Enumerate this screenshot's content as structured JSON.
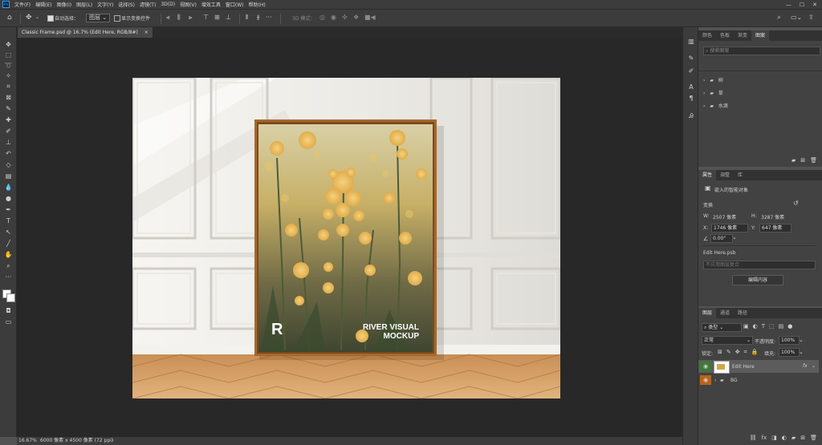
{
  "app": {
    "logo": "Ps"
  },
  "menu": [
    "文件(F)",
    "编辑(E)",
    "图像(I)",
    "图层(L)",
    "文字(Y)",
    "选择(S)",
    "滤镜(T)",
    "3D(D)",
    "视图(V)",
    "增效工具",
    "窗口(W)",
    "帮助(H)"
  ],
  "window_controls": {
    "minimize": "—",
    "maximize": "☐",
    "close": "✕"
  },
  "options": {
    "auto_select_label": "自动选择：",
    "auto_select_value": "图层",
    "show_transform_label": "显示变换控件",
    "mode3d_label": "3D 模式：",
    "more": "···"
  },
  "document_tab": {
    "title": "Classic Frame.psd @ 16.7% (Edit Here, RGB/8#)",
    "close": "×"
  },
  "artwork": {
    "watermark_letter": "R",
    "line1": "RIVER VISUAL",
    "line2": "MOCKUP"
  },
  "status": {
    "zoom": "16.67%",
    "doc_info": "6000 像素 x 4500 像素 (72 ppi)",
    "arrow": "›"
  },
  "color_panel": {
    "tabs": [
      "颜色",
      "色板",
      "渐变",
      "图案"
    ],
    "active_tab": 3,
    "search_placeholder": "搜索图案",
    "groups": [
      {
        "name": "树",
        "caret": "›"
      },
      {
        "name": "草",
        "caret": "›"
      },
      {
        "name": "水滴",
        "caret": "›"
      }
    ]
  },
  "properties": {
    "tabs": [
      "属性",
      "调整",
      "库"
    ],
    "active_tab": 0,
    "type_label": "嵌入的智能对象",
    "transform_label": "变换",
    "w_label": "W:",
    "w_value": "2507 像素",
    "h_label": "H:",
    "h_value": "3287 像素",
    "x_label": "X:",
    "x_value": "1746 像素",
    "y_label": "Y:",
    "y_value": "647 像素",
    "angle_value": "0.00°",
    "file_name": "Edit Here.psb",
    "comp_placeholder": "不应用图层复合",
    "edit_button": "编辑内容"
  },
  "layers": {
    "tabs": [
      "图层",
      "通道",
      "路径"
    ],
    "active_tab": 0,
    "filter_label": "类型",
    "blend_mode": "正常",
    "opacity_label": "不透明度:",
    "opacity_value": "100%",
    "lock_label": "锁定:",
    "fill_label": "填充:",
    "fill_value": "100%",
    "items": [
      {
        "name": "Edit Here",
        "fx": "fx",
        "selected": true,
        "eye_color": "#3f7a39"
      },
      {
        "name": "BG",
        "fx": "",
        "selected": false,
        "eye_color": "#b5641c",
        "caret": "›"
      }
    ],
    "bottom_icons": [
      "link-icon",
      "fx",
      "mask-icon",
      "adjustment-icon",
      "folder-icon",
      "new-layer-icon",
      "trash-icon"
    ],
    "fx_label": "fx"
  },
  "colors": {
    "ps_blue": "#2fa3f7",
    "panel_bg": "#424242",
    "app_bg": "#535353",
    "canvas_bg": "#282828"
  }
}
